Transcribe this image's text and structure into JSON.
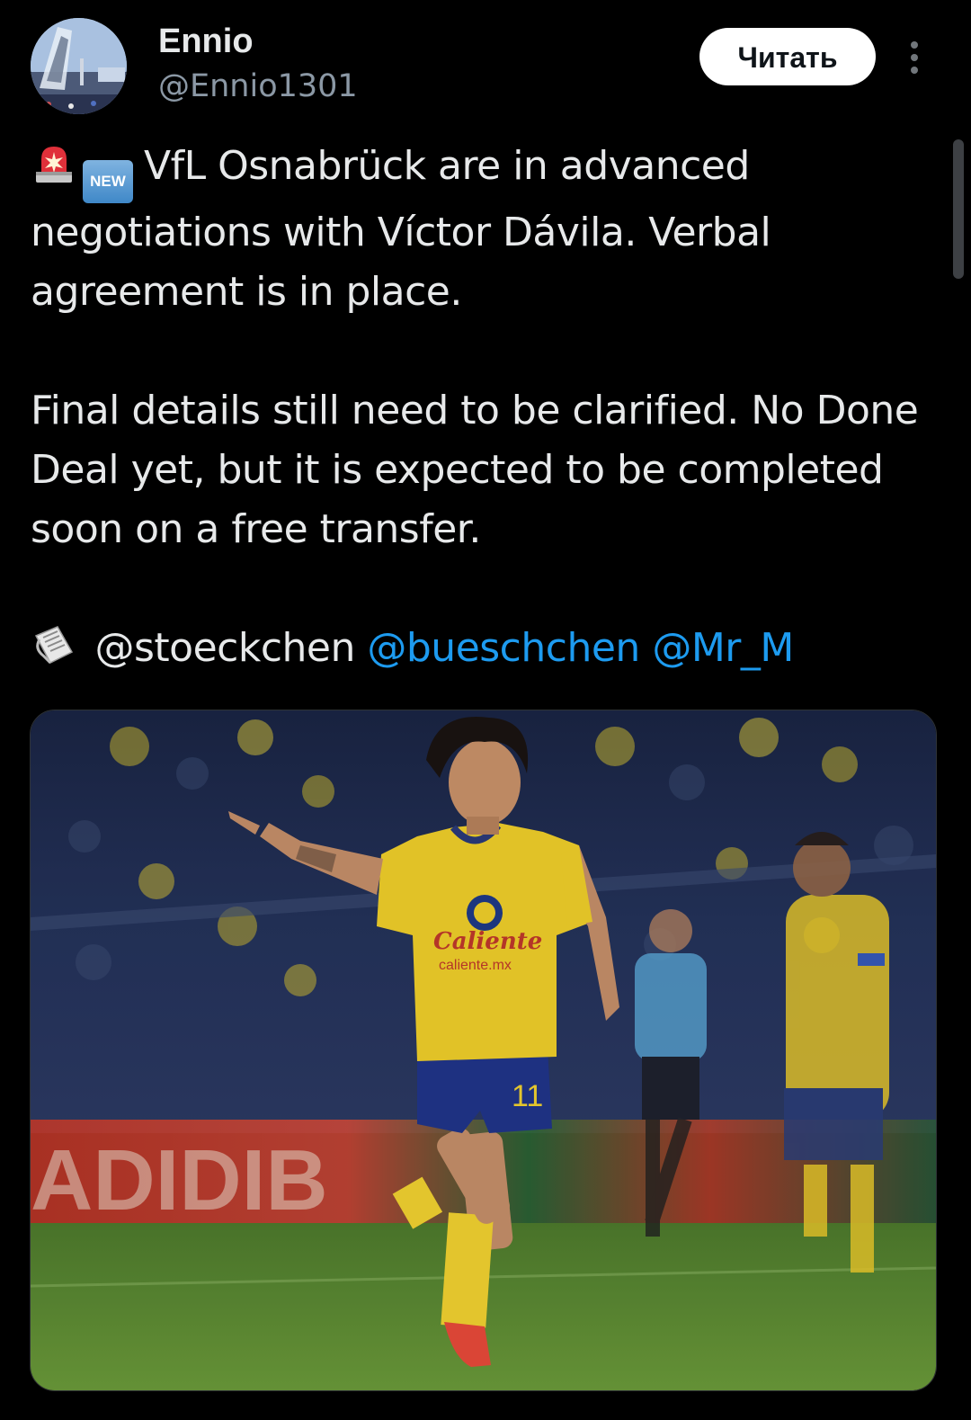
{
  "author": {
    "name": "Ennio",
    "handle": "@Ennio1301"
  },
  "actions": {
    "follow_label": "Читать",
    "more_icon": "more-vertical-icon"
  },
  "tweet": {
    "emoji_1": "police-light-icon",
    "badge_new": "NEW",
    "line_1": "VfL Osnabrück are in advanced negotiations with Víctor Dávila. Verbal agreement is in place.",
    "line_2": "Final details still need to be clarified. No Done Deal yet, but it is expected to be completed soon on a free transfer.",
    "emoji_3": "newspaper-icon",
    "mention_1": "@stoeckchen",
    "mention_2": "@bueschchen",
    "mention_3": "@Mr_M"
  },
  "media": {
    "jersey_sponsor": "Caliente",
    "jersey_sponsor_url": "caliente.mx",
    "player_number": "11",
    "ad_board_text": "ADIDIB"
  },
  "colors": {
    "background": "#000000",
    "text": "#e7e9ea",
    "secondary": "#8b98a5",
    "link": "#1d9bf0",
    "follow_button_bg": "#ffffff"
  }
}
